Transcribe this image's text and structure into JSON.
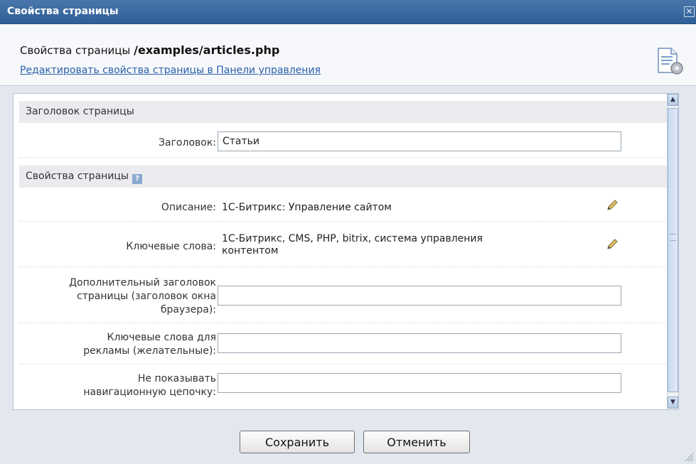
{
  "window": {
    "title": "Свойства страницы",
    "close_glyph": "✕"
  },
  "header": {
    "label": "Свойства страницы",
    "path": "/examples/articles.php",
    "link": "Редактировать свойства страницы в Панели управления",
    "icon": "page-settings-icon"
  },
  "sections": {
    "title": {
      "heading": "Заголовок страницы",
      "label": "Заголовок:",
      "value": "Статьи"
    },
    "properties": {
      "heading": "Свойства страницы",
      "help_glyph": "?",
      "description": {
        "label": "Описание:",
        "value": "1С-Битрикс: Управление сайтом"
      },
      "keywords": {
        "label": "Ключевые слова:",
        "value_line1": "1С-Битрикс, CMS, PHP, bitrix, система управления",
        "value_line2": "контентом"
      },
      "extra_title": {
        "label_line1": "Дополнительный заголовок",
        "label_line2": "страницы (заголовок окна",
        "label_line3": "браузера):",
        "value": ""
      },
      "ad_keywords": {
        "label_line1": "Ключевые слова для",
        "label_line2": "рекламы (желательные):",
        "value": ""
      },
      "hide_breadcrumb": {
        "label_line1": "Не показывать",
        "label_line2": "навигационную цепочку:",
        "value": ""
      }
    }
  },
  "buttons": {
    "save": "Сохранить",
    "cancel": "Отменить"
  }
}
